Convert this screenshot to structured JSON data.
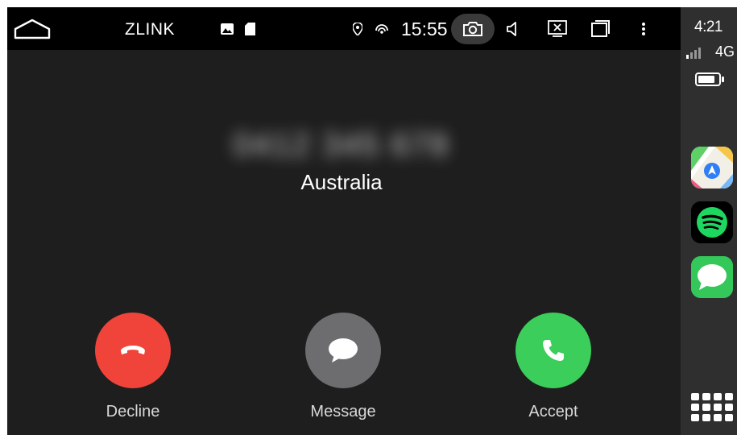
{
  "status_bar": {
    "app_name": "ZLINK",
    "time": "15:55",
    "icons": [
      "home-outline-icon",
      "image-icon",
      "sd-card-icon",
      "location-pin-icon",
      "wireless-icon",
      "camera-icon",
      "volume-icon",
      "screen-close-icon",
      "recent-apps-icon",
      "more-vert-icon"
    ]
  },
  "call": {
    "caller_number_obscured": "0412 345 678",
    "caller_location": "Australia",
    "decline_label": "Decline",
    "message_label": "Message",
    "accept_label": "Accept"
  },
  "dock": {
    "time": "4:21",
    "network": "4G",
    "battery_level": 0.85,
    "apps": [
      "maps-app-icon",
      "spotify-app-icon",
      "messages-app-icon"
    ],
    "grid_icon": "app-grid-icon"
  },
  "colors": {
    "decline": "#f0443a",
    "message": "#6d6d70",
    "accept": "#3bce5a",
    "background": "#1e1e1e",
    "status_bar": "#000000",
    "dock": "#2f2f2f"
  }
}
